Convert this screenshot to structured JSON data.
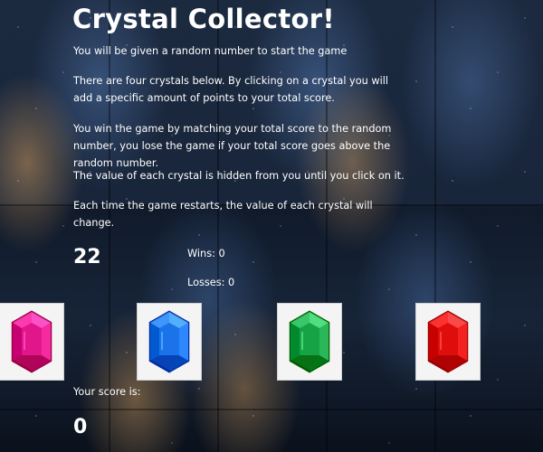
{
  "game": {
    "title": "Crystal Collector!",
    "instructions": [
      "You will be given a random number to start the game",
      "There are four crystals below. By clicking on a crystal you will add a specific amount of points to your total score.",
      "You win the game by matching your total score to the random number, you lose the game if your total score goes above the random number.",
      "The value of each crystal is hidden from you until you click on it.",
      "Each time the game restarts, the value of each crystal will change."
    ]
  },
  "stats": {
    "target_number": "22",
    "wins_text": "Wins: 0",
    "losses_text": "Losses: 0"
  },
  "crystals": [
    {
      "name": "pink-crystal",
      "color": "#e0168a"
    },
    {
      "name": "blue-crystal",
      "color": "#1a73e8"
    },
    {
      "name": "green-crystal",
      "color": "#15a346"
    },
    {
      "name": "red-crystal",
      "color": "#e00d0d"
    }
  ],
  "score": {
    "label": "Your score is:",
    "value": "0"
  }
}
